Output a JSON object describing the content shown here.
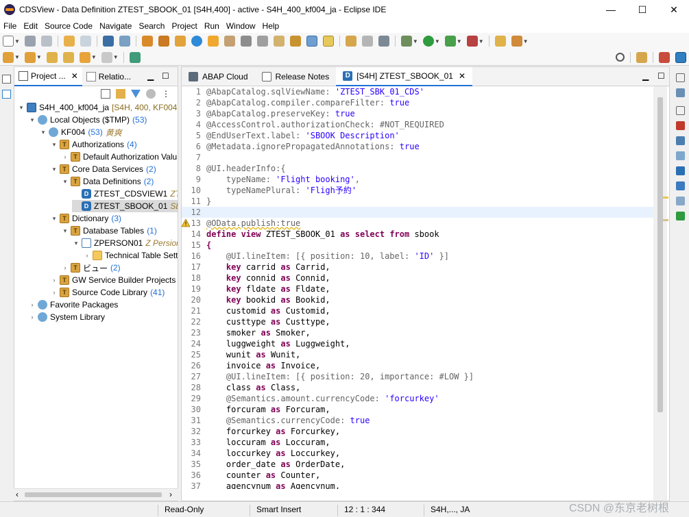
{
  "window": {
    "title": "CDSView - Data Definition ZTEST_SBOOK_01 [S4H,400] - active - S4H_400_kf004_ja - Eclipse IDE",
    "controls": [
      "—",
      "☐",
      "✕"
    ]
  },
  "menu": [
    "File",
    "Edit",
    "Source Code",
    "Navigate",
    "Search",
    "Project",
    "Run",
    "Window",
    "Help"
  ],
  "left_panel": {
    "tabs": [
      {
        "label": "Project ...",
        "closable": true
      },
      {
        "label": "Relatio...",
        "closable": false
      }
    ],
    "tree": [
      {
        "label": "S4H_400_kf004_ja",
        "suffix": "[S4H, 400, KF004, JA",
        "count": "",
        "dec": "",
        "icon": "proj",
        "depth": 0,
        "twisty": "▾"
      },
      {
        "label": "Local Objects ($TMP)",
        "suffix": "",
        "count": "(53)",
        "dec": "",
        "icon": "obj",
        "depth": 1,
        "twisty": "▾"
      },
      {
        "label": "KF004",
        "suffix": "",
        "count": "(53)",
        "dec": "黄爽",
        "icon": "obj",
        "depth": 2,
        "twisty": "▾"
      },
      {
        "label": "Authorizations",
        "suffix": "",
        "count": "(4)",
        "dec": "",
        "icon": "pkg",
        "depth": 3,
        "twisty": "▾"
      },
      {
        "label": "Default Authorization Valu",
        "suffix": "",
        "count": "",
        "dec": "",
        "icon": "pkg",
        "depth": 4,
        "twisty": "›"
      },
      {
        "label": "Core Data Services",
        "suffix": "",
        "count": "(2)",
        "dec": "",
        "icon": "pkg",
        "depth": 3,
        "twisty": "▾"
      },
      {
        "label": "Data Definitions",
        "suffix": "",
        "count": "(2)",
        "dec": "",
        "icon": "pkg",
        "depth": 4,
        "twisty": "▾"
      },
      {
        "label": "ZTEST_CDSVIEW1",
        "suffix": "",
        "count": "",
        "dec": "ZTe",
        "icon": "ddl",
        "depth": 5,
        "twisty": ""
      },
      {
        "label": "ZTEST_SBOOK_01",
        "suffix": "",
        "count": "",
        "dec": "SBo",
        "icon": "ddl",
        "depth": 5,
        "twisty": "",
        "selected": true
      },
      {
        "label": "Dictionary",
        "suffix": "",
        "count": "(3)",
        "dec": "",
        "icon": "pkg",
        "depth": 3,
        "twisty": "▾"
      },
      {
        "label": "Database Tables",
        "suffix": "",
        "count": "(1)",
        "dec": "",
        "icon": "pkg",
        "depth": 4,
        "twisty": "▾"
      },
      {
        "label": "ZPERSON01",
        "suffix": "",
        "count": "",
        "dec": "Z Persion",
        "icon": "table",
        "depth": 5,
        "twisty": "▾"
      },
      {
        "label": "Technical Table Setti",
        "suffix": "",
        "count": "",
        "dec": "",
        "icon": "folder",
        "depth": 6,
        "twisty": "›"
      },
      {
        "label": "ビュー",
        "suffix": "",
        "count": "(2)",
        "dec": "",
        "icon": "pkg",
        "depth": 4,
        "twisty": "›"
      },
      {
        "label": "GW Service Builder Projects",
        "suffix": "",
        "count": "(",
        "dec": "",
        "icon": "pkg",
        "depth": 3,
        "twisty": "›"
      },
      {
        "label": "Source Code Library",
        "suffix": "",
        "count": "(41)",
        "dec": "",
        "icon": "pkg",
        "depth": 3,
        "twisty": "›"
      },
      {
        "label": "Favorite Packages",
        "suffix": "",
        "count": "",
        "dec": "",
        "icon": "obj",
        "depth": 1,
        "twisty": "›"
      },
      {
        "label": "System Library",
        "suffix": "",
        "count": "",
        "dec": "",
        "icon": "obj",
        "depth": 1,
        "twisty": "›"
      }
    ]
  },
  "editor": {
    "tabs": [
      {
        "label": "ABAP Cloud",
        "active": false
      },
      {
        "label": "Release Notes",
        "active": false
      },
      {
        "label": "[S4H] ZTEST_SBOOK_01",
        "active": true
      }
    ],
    "lines": [
      [
        [
          "ann",
          "@AbapCatalog.sqlViewName: "
        ],
        [
          "str",
          "'ZTEST_SBK_01_CDS'"
        ]
      ],
      [
        [
          "ann",
          "@AbapCatalog.compiler.compareFilter: "
        ],
        [
          "bool",
          "true"
        ]
      ],
      [
        [
          "ann",
          "@AbapCatalog.preserveKey: "
        ],
        [
          "bool",
          "true"
        ]
      ],
      [
        [
          "ann",
          "@AccessControl.authorizationCheck: "
        ],
        [
          "ann",
          "#NOT_REQUIRED"
        ]
      ],
      [
        [
          "ann",
          "@EndUserText.label: "
        ],
        [
          "str",
          "'SBOOK Description'"
        ]
      ],
      [
        [
          "ann",
          "@Metadata.ignorePropagatedAnnotations: "
        ],
        [
          "bool",
          "true"
        ]
      ],
      [],
      [
        [
          "ann",
          "@UI.headerInfo:{"
        ]
      ],
      [
        [
          "ann",
          "    typeName: "
        ],
        [
          "str",
          "'Flight booking'"
        ],
        [
          "ann",
          ","
        ]
      ],
      [
        [
          "ann",
          "    typeNamePlural: "
        ],
        [
          "str",
          "'Fligh予約'"
        ]
      ],
      [
        [
          "ann",
          "}"
        ]
      ],
      [],
      [
        [
          "ann",
          "@OData.publish:true"
        ]
      ],
      [
        [
          "kw",
          "define view "
        ],
        [
          "id",
          "ZTEST_SBOOK_01 "
        ],
        [
          "kw",
          "as select from "
        ],
        [
          "id",
          "sbook"
        ]
      ],
      [
        [
          "kw",
          "{"
        ]
      ],
      [
        [
          "ann",
          "    @UI.lineItem: [{ position: 10, label: "
        ],
        [
          "str",
          "'ID'"
        ],
        [
          "ann",
          " }]"
        ]
      ],
      [
        [
          "id",
          "    "
        ],
        [
          "kw",
          "key "
        ],
        [
          "id",
          "carrid "
        ],
        [
          "kw",
          "as "
        ],
        [
          "id",
          "Carrid,"
        ]
      ],
      [
        [
          "id",
          "    "
        ],
        [
          "kw",
          "key "
        ],
        [
          "id",
          "connid "
        ],
        [
          "kw",
          "as "
        ],
        [
          "id",
          "Connid,"
        ]
      ],
      [
        [
          "id",
          "    "
        ],
        [
          "kw",
          "key "
        ],
        [
          "id",
          "fldate "
        ],
        [
          "kw",
          "as "
        ],
        [
          "id",
          "Fldate,"
        ]
      ],
      [
        [
          "id",
          "    "
        ],
        [
          "kw",
          "key "
        ],
        [
          "id",
          "bookid "
        ],
        [
          "kw",
          "as "
        ],
        [
          "id",
          "Bookid,"
        ]
      ],
      [
        [
          "id",
          "    customid "
        ],
        [
          "kw",
          "as "
        ],
        [
          "id",
          "Customid,"
        ]
      ],
      [
        [
          "id",
          "    custtype "
        ],
        [
          "kw",
          "as "
        ],
        [
          "id",
          "Custtype,"
        ]
      ],
      [
        [
          "id",
          "    smoker "
        ],
        [
          "kw",
          "as "
        ],
        [
          "id",
          "Smoker,"
        ]
      ],
      [
        [
          "id",
          "    luggweight "
        ],
        [
          "kw",
          "as "
        ],
        [
          "id",
          "Luggweight,"
        ]
      ],
      [
        [
          "id",
          "    wunit "
        ],
        [
          "kw",
          "as "
        ],
        [
          "id",
          "Wunit,"
        ]
      ],
      [
        [
          "id",
          "    invoice "
        ],
        [
          "kw",
          "as "
        ],
        [
          "id",
          "Invoice,"
        ]
      ],
      [
        [
          "ann",
          "    @UI.lineItem: [{ position: 20, importance: #LOW }]"
        ]
      ],
      [
        [
          "id",
          "    class "
        ],
        [
          "kw",
          "as "
        ],
        [
          "id",
          "Class,"
        ]
      ],
      [
        [
          "ann",
          "    @Semantics.amount.currencyCode: "
        ],
        [
          "str",
          "'forcurkey'"
        ]
      ],
      [
        [
          "id",
          "    forcuram "
        ],
        [
          "kw",
          "as "
        ],
        [
          "id",
          "Forcuram,"
        ]
      ],
      [
        [
          "ann",
          "    @Semantics.currencyCode: "
        ],
        [
          "bool",
          "true"
        ]
      ],
      [
        [
          "id",
          "    forcurkey "
        ],
        [
          "kw",
          "as "
        ],
        [
          "id",
          "Forcurkey,"
        ]
      ],
      [
        [
          "id",
          "    loccuram "
        ],
        [
          "kw",
          "as "
        ],
        [
          "id",
          "Loccuram,"
        ]
      ],
      [
        [
          "id",
          "    loccurkey "
        ],
        [
          "kw",
          "as "
        ],
        [
          "id",
          "Loccurkey,"
        ]
      ],
      [
        [
          "id",
          "    order_date "
        ],
        [
          "kw",
          "as "
        ],
        [
          "id",
          "OrderDate,"
        ]
      ],
      [
        [
          "id",
          "    counter "
        ],
        [
          "kw",
          "as "
        ],
        [
          "id",
          "Counter,"
        ]
      ],
      [
        [
          "id",
          "    agencynum "
        ],
        [
          "kw",
          "as "
        ],
        [
          "id",
          "Agencynum,"
        ]
      ]
    ]
  },
  "status": {
    "mode": "Read-Only",
    "insert": "Smart Insert",
    "position": "12 : 1 : 344",
    "system": "S4H,..., JA"
  },
  "watermark": "CSDN @东京老树根"
}
